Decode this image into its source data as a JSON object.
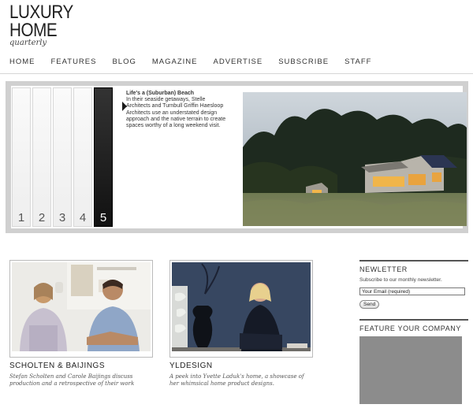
{
  "logo": {
    "line1": "LUXURY",
    "line2": "HOME",
    "sub": "quarterly"
  },
  "nav": [
    {
      "label": "HOME"
    },
    {
      "label": "FEATURES"
    },
    {
      "label": "BLOG"
    },
    {
      "label": "MAGAZINE"
    },
    {
      "label": "ADVERTISE"
    },
    {
      "label": "SUBSCRIBE"
    },
    {
      "label": "STAFF"
    }
  ],
  "slider": {
    "tabs": [
      "1",
      "2",
      "3",
      "4",
      "5"
    ],
    "active_tab": "5",
    "title": "Life's a (Suburban) Beach",
    "text": "In their seaside getaways, Stelle Architects and Turnbull Griffin Haesloop Architects use an understated design approach and the native terrain to create spaces worthy of a long weekend visit."
  },
  "cards": [
    {
      "title": "SCHOLTEN & BAIJINGS",
      "desc": "Stefan Scholten and Carole Baijings discuss production and a retrospective of their work"
    },
    {
      "title": "YLDESIGN",
      "desc": "A peek into Yvette Laduk's home, a showcase of her whimsical home product designs."
    }
  ],
  "newsletter": {
    "title": "NEWLETTER",
    "text": "Subscribe to our monthly newsletter.",
    "email_value": "Your Email (required)",
    "send_label": "Send"
  },
  "feature": {
    "title": "FEATURE YOUR COMPANY"
  }
}
